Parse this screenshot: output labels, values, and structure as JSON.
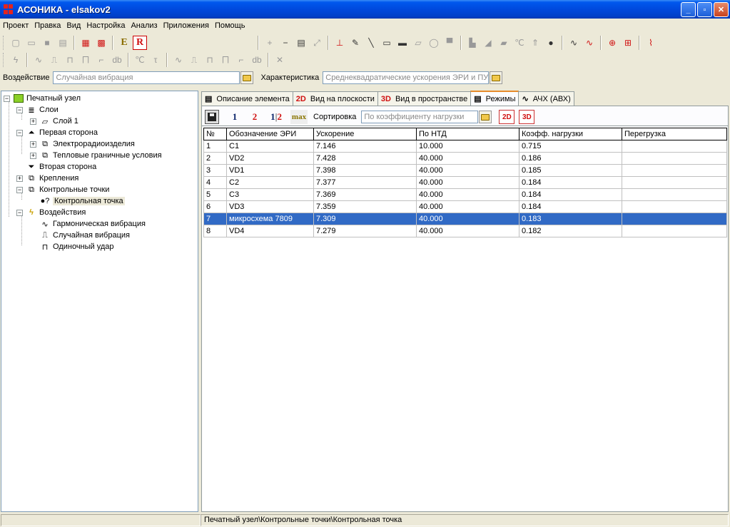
{
  "window": {
    "title": "АСОНИКА - elsakov2"
  },
  "menu": [
    "Проект",
    "Правка",
    "Вид",
    "Настройка",
    "Анализ",
    "Приложения",
    "Помощь"
  ],
  "filters": {
    "impact_label": "Воздействие",
    "impact_value": "Случайная вибрация",
    "characteristic_label": "Характеристика",
    "characteristic_value": "Среднеквадратические ускорения ЭРИ и ПУ"
  },
  "tree": {
    "root": "Печатный узел",
    "layers": "Слои",
    "layer1": "Слой 1",
    "side1": "Первая сторона",
    "electro": "Электрорадиоизделия",
    "thermal": "Тепловые граничные условия",
    "side2": "Вторая сторона",
    "mounts": "Крепления",
    "checkpoints": "Контрольные точки",
    "checkpoint": "Контрольная точка",
    "impacts": "Воздействия",
    "harmonic": "Гармоническая вибрация",
    "random": "Случайная вибрация",
    "shock": "Одиночный удар"
  },
  "tabs": [
    {
      "label": "Описание элемента",
      "icon": "doc-icon"
    },
    {
      "label": "Вид на плоскости",
      "icon": "2D"
    },
    {
      "label": "Вид в пространстве",
      "icon": "3D"
    },
    {
      "label": "Режимы",
      "icon": "doc-icon"
    },
    {
      "label": "АЧХ (АВХ)",
      "icon": "freq-icon"
    }
  ],
  "toolbar_modes": {
    "btn1": "1",
    "btn2": "2",
    "btn12a": "1",
    "btn12b": "2",
    "max": "max",
    "sort_label": "Сортировка",
    "sort_value": "По коэффициенту нагрузки",
    "view2d": "2D",
    "view3d": "3D"
  },
  "table": {
    "headers": [
      "№",
      "Обозначение ЭРИ",
      "Ускорение",
      "По НТД",
      "Коэфф. нагрузки",
      "Перегрузка"
    ],
    "rows": [
      [
        "1",
        "C1",
        "7.146",
        "10.000",
        "0.715",
        ""
      ],
      [
        "2",
        "VD2",
        "7.428",
        "40.000",
        "0.186",
        ""
      ],
      [
        "3",
        "VD1",
        "7.398",
        "40.000",
        "0.185",
        ""
      ],
      [
        "4",
        "C2",
        "7.377",
        "40.000",
        "0.184",
        ""
      ],
      [
        "5",
        "C3",
        "7.369",
        "40.000",
        "0.184",
        ""
      ],
      [
        "6",
        "VD3",
        "7.359",
        "40.000",
        "0.184",
        ""
      ],
      [
        "7",
        "микросхема 7809",
        "7.309",
        "40.000",
        "0.183",
        ""
      ],
      [
        "8",
        "VD4",
        "7.279",
        "40.000",
        "0.182",
        ""
      ]
    ],
    "selected_row": 7
  },
  "status": {
    "path": "Печатный узел\\Контрольные точки\\Контрольная точка"
  },
  "colors": {
    "titlebar": "#0049dd",
    "selection": "#316ac5",
    "accent_red": "#d01010"
  }
}
